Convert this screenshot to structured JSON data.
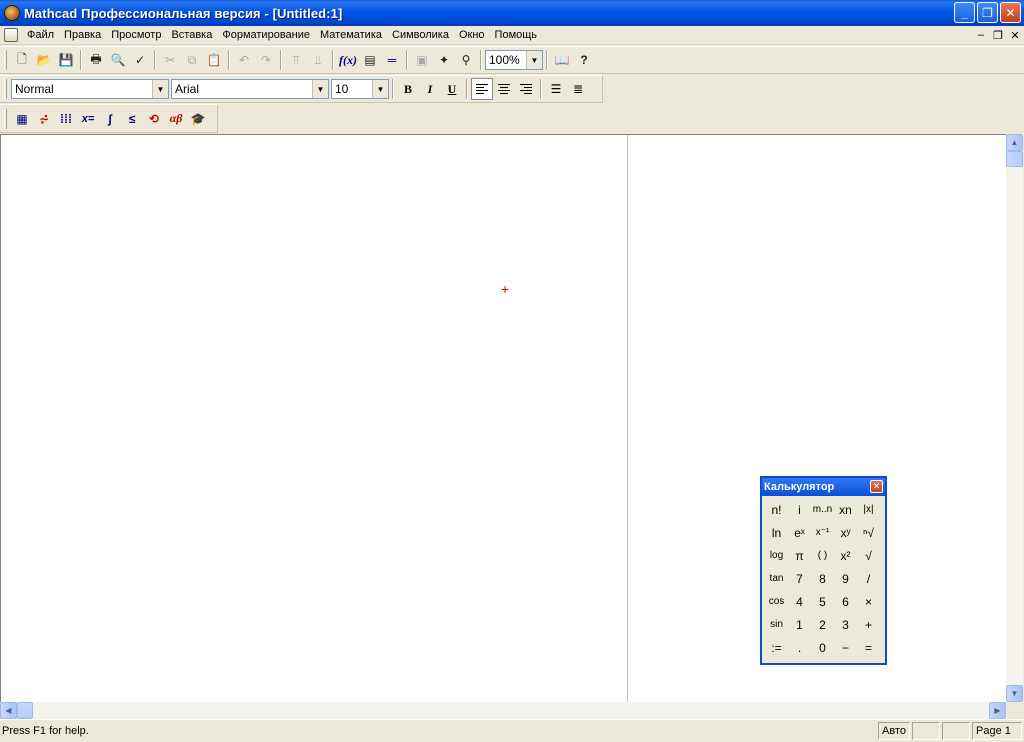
{
  "window": {
    "title": "Mathcad Профессиональная версия - [Untitled:1]"
  },
  "menu": {
    "items": [
      "Файл",
      "Правка",
      "Просмотр",
      "Вставка",
      "Форматирование",
      "Математика",
      "Символика",
      "Окно",
      "Помощь"
    ]
  },
  "format_toolbar": {
    "style": "Normal",
    "font": "Arial",
    "size": "10",
    "bold": "B",
    "italic": "I",
    "underline": "U"
  },
  "standard_toolbar": {
    "zoom": "100%",
    "fx": "f(x)"
  },
  "math_toolbar": {
    "eval_label": "x=",
    "greek_label": "αβ"
  },
  "statusbar": {
    "help": "Press F1 for help.",
    "mode": "Авто",
    "page": "Page 1"
  },
  "calculator": {
    "title": "Калькулятор",
    "keys": [
      "n!",
      "i",
      "m..n",
      "xn",
      "|x|",
      "ln",
      "eˣ",
      "x⁻¹",
      "xʸ",
      "ⁿ√",
      "log",
      "π",
      "( )",
      "x²",
      "√",
      "tan",
      "7",
      "8",
      "9",
      "/",
      "cos",
      "4",
      "5",
      "6",
      "×",
      "sin",
      "1",
      "2",
      "3",
      "+",
      ":=",
      ".",
      "0",
      "−",
      "="
    ]
  },
  "colors": {
    "titlebar": "#0055e5",
    "cursor": "#e00000",
    "chrome": "#ece9d8"
  }
}
